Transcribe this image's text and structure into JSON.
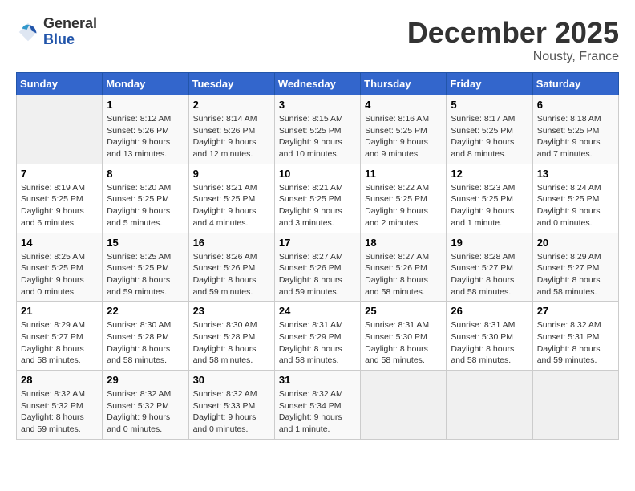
{
  "header": {
    "logo_general": "General",
    "logo_blue": "Blue",
    "month_title": "December 2025",
    "location": "Nousty, France"
  },
  "days_of_week": [
    "Sunday",
    "Monday",
    "Tuesday",
    "Wednesday",
    "Thursday",
    "Friday",
    "Saturday"
  ],
  "weeks": [
    [
      {
        "num": "",
        "empty": true
      },
      {
        "num": "1",
        "sunrise": "8:12 AM",
        "sunset": "5:26 PM",
        "daylight": "9 hours and 13 minutes."
      },
      {
        "num": "2",
        "sunrise": "8:14 AM",
        "sunset": "5:26 PM",
        "daylight": "9 hours and 12 minutes."
      },
      {
        "num": "3",
        "sunrise": "8:15 AM",
        "sunset": "5:25 PM",
        "daylight": "9 hours and 10 minutes."
      },
      {
        "num": "4",
        "sunrise": "8:16 AM",
        "sunset": "5:25 PM",
        "daylight": "9 hours and 9 minutes."
      },
      {
        "num": "5",
        "sunrise": "8:17 AM",
        "sunset": "5:25 PM",
        "daylight": "9 hours and 8 minutes."
      },
      {
        "num": "6",
        "sunrise": "8:18 AM",
        "sunset": "5:25 PM",
        "daylight": "9 hours and 7 minutes."
      }
    ],
    [
      {
        "num": "7",
        "sunrise": "8:19 AM",
        "sunset": "5:25 PM",
        "daylight": "9 hours and 6 minutes."
      },
      {
        "num": "8",
        "sunrise": "8:20 AM",
        "sunset": "5:25 PM",
        "daylight": "9 hours and 5 minutes."
      },
      {
        "num": "9",
        "sunrise": "8:21 AM",
        "sunset": "5:25 PM",
        "daylight": "9 hours and 4 minutes."
      },
      {
        "num": "10",
        "sunrise": "8:21 AM",
        "sunset": "5:25 PM",
        "daylight": "9 hours and 3 minutes."
      },
      {
        "num": "11",
        "sunrise": "8:22 AM",
        "sunset": "5:25 PM",
        "daylight": "9 hours and 2 minutes."
      },
      {
        "num": "12",
        "sunrise": "8:23 AM",
        "sunset": "5:25 PM",
        "daylight": "9 hours and 1 minute."
      },
      {
        "num": "13",
        "sunrise": "8:24 AM",
        "sunset": "5:25 PM",
        "daylight": "9 hours and 0 minutes."
      }
    ],
    [
      {
        "num": "14",
        "sunrise": "8:25 AM",
        "sunset": "5:25 PM",
        "daylight": "9 hours and 0 minutes."
      },
      {
        "num": "15",
        "sunrise": "8:25 AM",
        "sunset": "5:25 PM",
        "daylight": "8 hours and 59 minutes."
      },
      {
        "num": "16",
        "sunrise": "8:26 AM",
        "sunset": "5:26 PM",
        "daylight": "8 hours and 59 minutes."
      },
      {
        "num": "17",
        "sunrise": "8:27 AM",
        "sunset": "5:26 PM",
        "daylight": "8 hours and 59 minutes."
      },
      {
        "num": "18",
        "sunrise": "8:27 AM",
        "sunset": "5:26 PM",
        "daylight": "8 hours and 58 minutes."
      },
      {
        "num": "19",
        "sunrise": "8:28 AM",
        "sunset": "5:27 PM",
        "daylight": "8 hours and 58 minutes."
      },
      {
        "num": "20",
        "sunrise": "8:29 AM",
        "sunset": "5:27 PM",
        "daylight": "8 hours and 58 minutes."
      }
    ],
    [
      {
        "num": "21",
        "sunrise": "8:29 AM",
        "sunset": "5:27 PM",
        "daylight": "8 hours and 58 minutes."
      },
      {
        "num": "22",
        "sunrise": "8:30 AM",
        "sunset": "5:28 PM",
        "daylight": "8 hours and 58 minutes."
      },
      {
        "num": "23",
        "sunrise": "8:30 AM",
        "sunset": "5:28 PM",
        "daylight": "8 hours and 58 minutes."
      },
      {
        "num": "24",
        "sunrise": "8:31 AM",
        "sunset": "5:29 PM",
        "daylight": "8 hours and 58 minutes."
      },
      {
        "num": "25",
        "sunrise": "8:31 AM",
        "sunset": "5:30 PM",
        "daylight": "8 hours and 58 minutes."
      },
      {
        "num": "26",
        "sunrise": "8:31 AM",
        "sunset": "5:30 PM",
        "daylight": "8 hours and 58 minutes."
      },
      {
        "num": "27",
        "sunrise": "8:32 AM",
        "sunset": "5:31 PM",
        "daylight": "8 hours and 59 minutes."
      }
    ],
    [
      {
        "num": "28",
        "sunrise": "8:32 AM",
        "sunset": "5:32 PM",
        "daylight": "8 hours and 59 minutes."
      },
      {
        "num": "29",
        "sunrise": "8:32 AM",
        "sunset": "5:32 PM",
        "daylight": "9 hours and 0 minutes."
      },
      {
        "num": "30",
        "sunrise": "8:32 AM",
        "sunset": "5:33 PM",
        "daylight": "9 hours and 0 minutes."
      },
      {
        "num": "31",
        "sunrise": "8:32 AM",
        "sunset": "5:34 PM",
        "daylight": "9 hours and 1 minute."
      },
      {
        "num": "",
        "empty": true
      },
      {
        "num": "",
        "empty": true
      },
      {
        "num": "",
        "empty": true
      }
    ]
  ],
  "labels": {
    "sunrise_prefix": "Sunrise: ",
    "sunset_prefix": "Sunset: ",
    "daylight_prefix": "Daylight: "
  }
}
